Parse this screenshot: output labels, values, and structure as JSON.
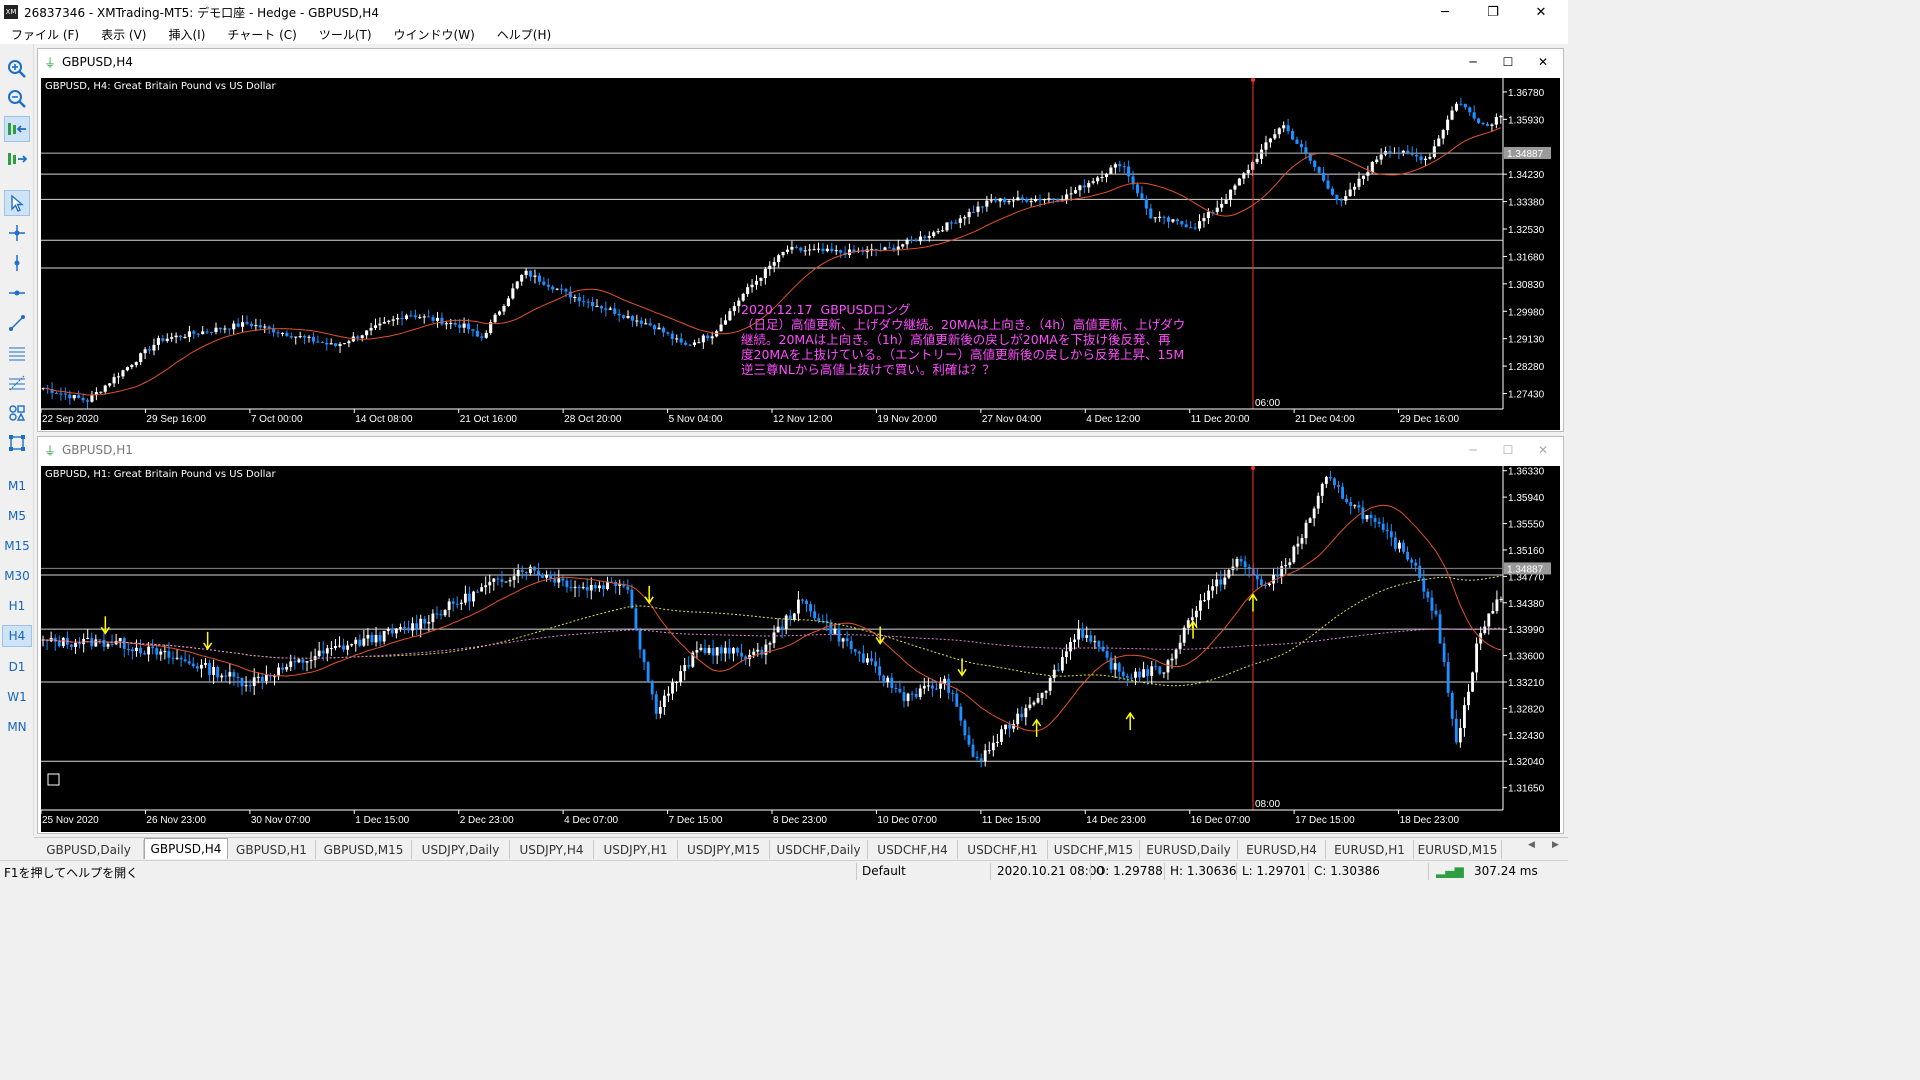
{
  "window": {
    "title": "26837346 - XMTrading-MT5: デモ口座 - Hedge - GBPUSD,H4",
    "icon_text": "XM",
    "controls": [
      "minimize-icon",
      "restore-icon",
      "close-icon"
    ]
  },
  "menu": [
    "ファイル (F)",
    "表示 (V)",
    "挿入(I)",
    "チャート (C)",
    "ツール(T)",
    "ウインドウ(W)",
    "ヘルプ(H)"
  ],
  "toolbar": {
    "tools": [
      "zoom-in-icon",
      "zoom-out-icon",
      "chart-scroll-icon",
      "chart-shift-icon",
      "cursor-icon",
      "crosshair-icon",
      "vertical-line-icon",
      "horizontal-line-icon",
      "trendline-icon",
      "channel-icon",
      "fibonacci-icon",
      "shapes-icon",
      "object-list-icon"
    ],
    "timeframes": [
      "M1",
      "M5",
      "M15",
      "M30",
      "H1",
      "H4",
      "D1",
      "W1",
      "MN"
    ],
    "selected_timeframe": "H4"
  },
  "chart_h4": {
    "window_title": "GBPUSD,H4",
    "symbol_label": "GBPUSD, H4:  Great Britain Pound vs US Dollar",
    "price_labels": [
      "1.36780",
      "1.35930",
      "1.34230",
      "1.33380",
      "1.32530",
      "1.31680",
      "1.30830",
      "1.29980",
      "1.29130",
      "1.28280",
      "1.27430"
    ],
    "price_values": [
      1.3678,
      1.3593,
      1.3423,
      1.3338,
      1.3253,
      1.3168,
      1.3083,
      1.2998,
      1.2913,
      1.2828,
      1.2743
    ],
    "current_price": "1.34887",
    "time_labels": [
      "22 Sep 2020",
      "29 Sep 16:00",
      "7 Oct 00:00",
      "14 Oct 08:00",
      "21 Oct 16:00",
      "28 Oct 20:00",
      "5 Nov 04:00",
      "12 Nov 12:00",
      "19 Nov 20:00",
      "27 Nov 04:00",
      "4 Dec 12:00",
      "11 Dec 20:00",
      "21 Dec 04:00",
      "29 Dec 16:00"
    ],
    "crosshair_time": "06:00",
    "horizontal_levels": [
      1.3488,
      1.3423,
      1.3345,
      1.3218,
      1.3132
    ],
    "annotation": "2020.12.17  GBPUSDロング\n（日足）高値更新、上げダウ継続。20MAは上向き。（4h）高値更新、上げダウ\n継続。20MAは上向き。（1h）高値更新後の戻しが20MAを下抜け後反発、再\n度20MAを上抜けている。（エントリー）高値更新後の戻しから反発上昇、15M\n逆三尊NLから高値上抜けで買い。利確は？？",
    "colors": {
      "bull": "#ffffff",
      "bear": "#1e90ff",
      "ma": "#e0522a",
      "crosshair": "#ff3030",
      "annotation": "#ff4dff"
    }
  },
  "chart_h1": {
    "window_title": "GBPUSD,H1",
    "symbol_label": "GBPUSD, H1:  Great Britain Pound vs US Dollar",
    "price_labels": [
      "1.36330",
      "1.35940",
      "1.35550",
      "1.35160",
      "1.34770",
      "1.34380",
      "1.33990",
      "1.33600",
      "1.33210",
      "1.32820",
      "1.32430",
      "1.32040",
      "1.31650"
    ],
    "price_values": [
      1.3633,
      1.3594,
      1.3555,
      1.3516,
      1.3477,
      1.3438,
      1.3399,
      1.336,
      1.3321,
      1.3282,
      1.3243,
      1.3204,
      1.3165
    ],
    "current_price": "1.34887",
    "time_labels": [
      "25 Nov 2020",
      "26 Nov 23:00",
      "30 Nov 07:00",
      "1 Dec 15:00",
      "2 Dec 23:00",
      "4 Dec 07:00",
      "7 Dec 15:00",
      "8 Dec 23:00",
      "10 Dec 07:00",
      "11 Dec 15:00",
      "14 Dec 23:00",
      "16 Dec 07:00",
      "17 Dec 15:00",
      "18 Dec 23:00"
    ],
    "crosshair_time": "08:00",
    "horizontal_levels": [
      1.3479,
      1.3399,
      1.3321,
      1.3204
    ],
    "down_arrows": [
      "26 Nov",
      "27 Nov",
      "4 Dec",
      "9 Dec",
      "10 Dec"
    ],
    "up_arrows": [
      "11 Dec",
      "14 Dec",
      "15 Dec",
      "16 Dec"
    ],
    "colors": {
      "bull": "#ffffff",
      "bear": "#1e90ff",
      "ma_fast": "#e0522a",
      "ma_mid": "#e0e040",
      "ma_slow": "#e080e0",
      "arrow": "#ffff00",
      "crosshair": "#ff3030"
    }
  },
  "tabs": [
    "GBPUSD,Daily",
    "GBPUSD,H4",
    "GBPUSD,H1",
    "GBPUSD,M15",
    "USDJPY,Daily",
    "USDJPY,H4",
    "USDJPY,H1",
    "USDJPY,M15",
    "USDCHF,Daily",
    "USDCHF,H4",
    "USDCHF,H1",
    "USDCHF,M15",
    "EURUSD,Daily",
    "EURUSD,H4",
    "EURUSD,H1",
    "EURUSD,M15"
  ],
  "active_tab": "GBPUSD,H4",
  "status": {
    "help": "F1を押してヘルプを開く",
    "profile": "Default",
    "datetime": "2020.10.21 08:00",
    "open": "O: 1.29788",
    "high": "H: 1.30636",
    "low": "L: 1.29701",
    "close": "C: 1.30386",
    "ping": "307.24 ms"
  }
}
